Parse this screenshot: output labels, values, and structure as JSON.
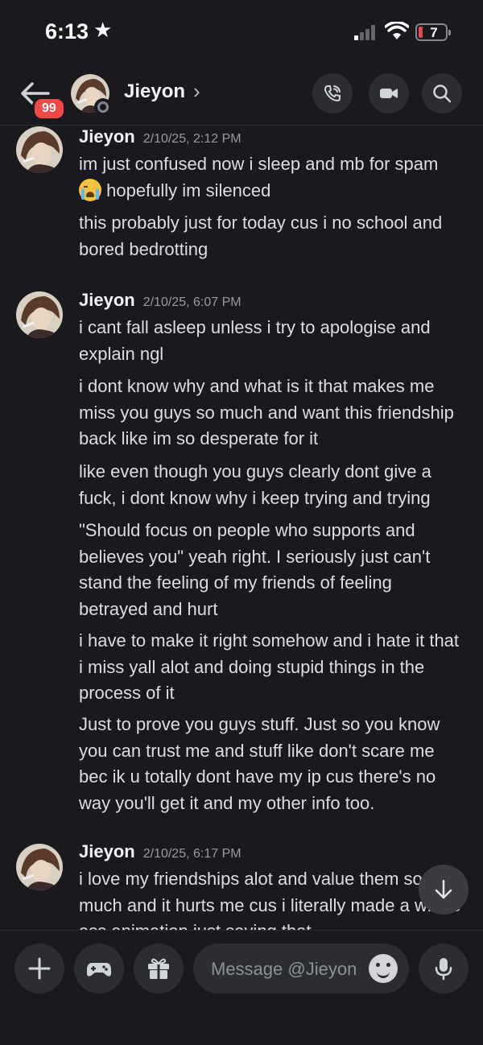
{
  "status_bar": {
    "time": "6:13",
    "battery": "7",
    "battery_color": "#e5484d"
  },
  "header": {
    "unread_badge": "99",
    "contact_name": "Jieyon",
    "chevron": "›",
    "icons": [
      "back-arrow-icon",
      "phone-call-icon",
      "video-camera-icon",
      "search-icon"
    ]
  },
  "messages": [
    {
      "author": "Jieyon",
      "timestamp": "2/10/25, 2:12 PM",
      "lines": [
        {
          "before": "im just confused now i sleep and mb for spam",
          "after": " hopefully im silenced",
          "emoji": "loudly-crying-face-icon"
        },
        {
          "text": "this probably just for today cus i no school and bored bedrotting"
        }
      ]
    },
    {
      "author": "Jieyon",
      "timestamp": "2/10/25, 6:07 PM",
      "lines": [
        {
          "text": "i cant fall asleep unless i try to apologise and explain ngl"
        },
        {
          "text": "i dont know why and what is it that makes me miss you guys so much and want this friendship back like im so desperate for it"
        },
        {
          "text": "like even though you guys clearly dont give a fuck, i dont know why i keep trying and trying"
        },
        {
          "text": "\"Should focus on people who supports and believes you\" yeah right. I seriously just can't stand the feeling of my friends of feeling betrayed and hurt"
        },
        {
          "text": "i have to make it right somehow and i hate it that i miss yall alot and doing stupid things in the process of it"
        },
        {
          "text": "Just to prove you guys stuff. Just so you know you can trust me and stuff like don't scare me bec ik u totally dont have my ip cus there's no way you'll get it and my other info too."
        }
      ]
    },
    {
      "author": "Jieyon",
      "timestamp": "2/10/25, 6:17 PM",
      "lines": [
        {
          "text": "i love my friendships alot and value them so much and it hurts me cus i literally made a whole ass animation just saying that"
        }
      ]
    }
  ],
  "composer": {
    "placeholder": "Message @Jieyon",
    "icons": [
      "plus-icon",
      "gamepad-icon",
      "gift-icon",
      "emoji-icon",
      "microphone-icon"
    ]
  }
}
